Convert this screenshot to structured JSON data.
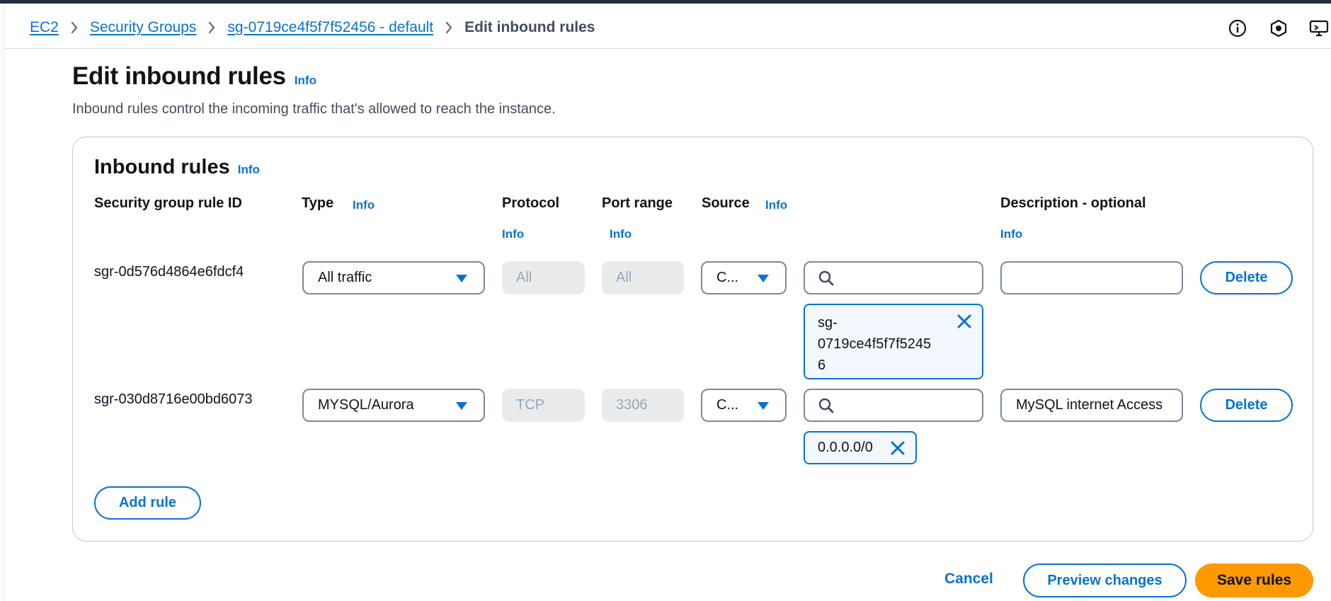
{
  "breadcrumb": {
    "items": [
      "EC2",
      "Security Groups",
      "sg-0719ce4f5f7f52456 - default"
    ],
    "current": "Edit inbound rules"
  },
  "utility_icons": [
    "info-circle-icon",
    "notifications-icon",
    "display-preferences-icon"
  ],
  "page": {
    "title": "Edit inbound rules",
    "info": "Info",
    "description": "Inbound rules control the incoming traffic that's allowed to reach the instance."
  },
  "rules_section": {
    "title": "Inbound rules",
    "info": "Info",
    "columns": {
      "rule_id": "Security group rule ID",
      "type": "Type",
      "protocol": "Protocol",
      "port_range": "Port range",
      "source": "Source",
      "description": "Description - optional",
      "info": "Info"
    },
    "rows": [
      {
        "rule_id": "sgr-0d576d4864e6fdcf4",
        "type": "All traffic",
        "protocol": "All",
        "port_range": "All",
        "source_type": "C...",
        "source_search": "",
        "source_token_lines": [
          "sg-",
          "0719ce4f5f7f5245",
          "6"
        ],
        "description": "",
        "delete_label": "Delete"
      },
      {
        "rule_id": "sgr-030d8716e00bd6073",
        "type": "MYSQL/Aurora",
        "protocol": "TCP",
        "port_range": "3306",
        "source_type": "C...",
        "source_search": "",
        "source_token": "0.0.0.0/0",
        "description": "MySQL internet Access",
        "delete_label": "Delete"
      }
    ],
    "add_rule_label": "Add rule"
  },
  "footer": {
    "cancel_label": "Cancel",
    "preview_label": "Preview changes",
    "save_label": "Save rules"
  },
  "colors": {
    "link": "#0972d3",
    "primary_button": "#ff9900",
    "token_background": "#f2f8fd"
  }
}
